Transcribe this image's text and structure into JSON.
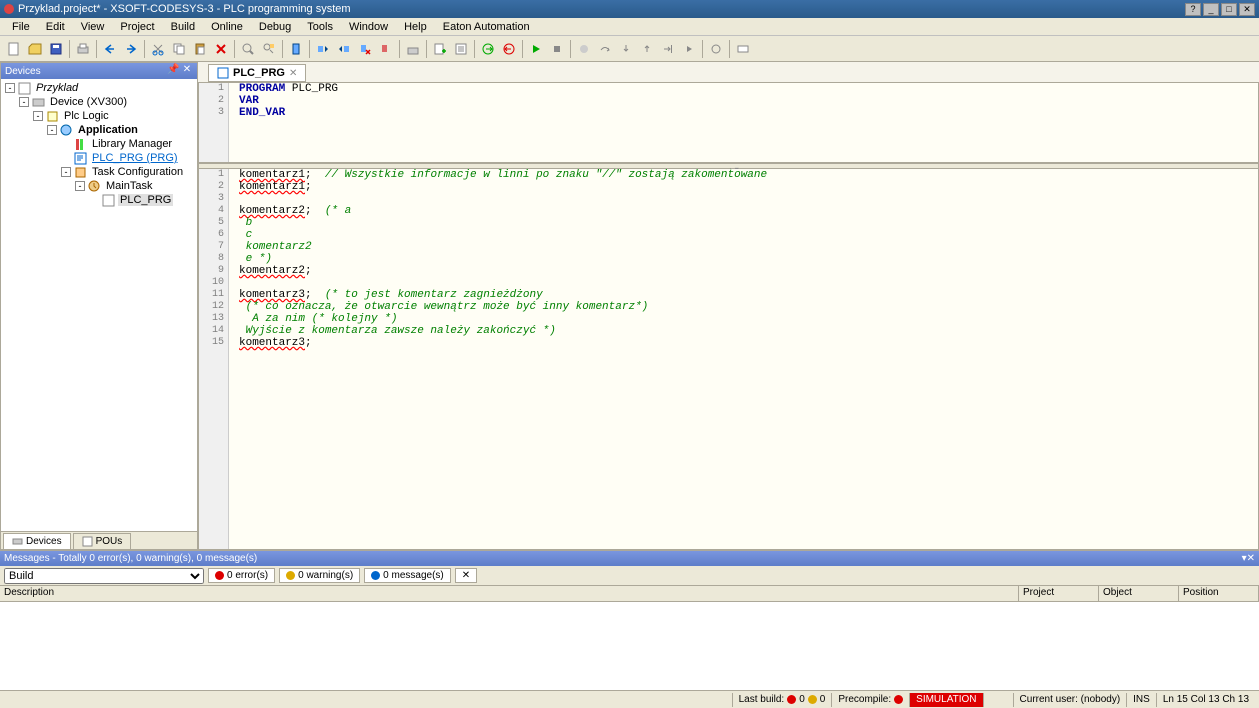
{
  "title": "Przyklad.project* - XSOFT-CODESYS-3 - PLC programming system",
  "menu": [
    "File",
    "Edit",
    "View",
    "Project",
    "Build",
    "Online",
    "Debug",
    "Tools",
    "Window",
    "Help",
    "Eaton Automation"
  ],
  "devicesPanel": {
    "title": "Devices"
  },
  "tree": {
    "root": "Przyklad",
    "device": "Device (XV300)",
    "plclogic": "Plc Logic",
    "app": "Application",
    "libmgr": "Library Manager",
    "plcprg": "PLC_PRG (PRG)",
    "taskcfg": "Task Configuration",
    "maintask": "MainTask",
    "plcprg2": "PLC_PRG"
  },
  "bottomTabs": {
    "devices": "Devices",
    "pous": "POUs"
  },
  "editorTab": "PLC_PRG",
  "declLines": [
    {
      "n": "1",
      "t": [
        {
          "kw": "PROGRAM"
        },
        {
          "tx": " PLC_PRG"
        }
      ]
    },
    {
      "n": "2",
      "t": [
        {
          "kw": "VAR"
        }
      ]
    },
    {
      "n": "3",
      "t": [
        {
          "kw": "END_VAR"
        }
      ]
    }
  ],
  "bodyLines": [
    {
      "n": "1",
      "t": [
        {
          "ru": "komentarz1"
        },
        {
          "tx": ";  "
        },
        {
          "cm": "// Wszystkie informacje w linni po znaku \"//\" zostają zakomentowane"
        }
      ]
    },
    {
      "n": "2",
      "t": [
        {
          "ru": "komentarz1"
        },
        {
          "tx": ";"
        }
      ]
    },
    {
      "n": "3",
      "t": []
    },
    {
      "n": "4",
      "t": [
        {
          "ru": "komentarz2"
        },
        {
          "tx": ";  "
        },
        {
          "cm": "(* a"
        }
      ]
    },
    {
      "n": "5",
      "t": [
        {
          "cm": " b"
        }
      ]
    },
    {
      "n": "6",
      "t": [
        {
          "cm": " c"
        }
      ]
    },
    {
      "n": "7",
      "t": [
        {
          "cm": " komentarz2"
        }
      ]
    },
    {
      "n": "8",
      "t": [
        {
          "cm": " e *)"
        }
      ]
    },
    {
      "n": "9",
      "t": [
        {
          "ru": "komentarz2"
        },
        {
          "tx": ";"
        }
      ]
    },
    {
      "n": "10",
      "t": []
    },
    {
      "n": "11",
      "t": [
        {
          "ru": "komentarz3"
        },
        {
          "tx": ";  "
        },
        {
          "cm": "(* to jest komentarz zagnieżdżony"
        }
      ]
    },
    {
      "n": "12",
      "t": [
        {
          "cm": " (* co oznacza, że otwarcie wewnątrz może być inny komentarz*)"
        }
      ]
    },
    {
      "n": "13",
      "t": [
        {
          "cm": "  A za nim (* kolejny *)"
        }
      ]
    },
    {
      "n": "14",
      "t": [
        {
          "cm": " Wyjście z komentarza zawsze należy zakończyć *)"
        }
      ]
    },
    {
      "n": "15",
      "t": [
        {
          "ru": "komentarz3"
        },
        {
          "tx": ";"
        }
      ]
    }
  ],
  "messages": {
    "header": "Messages - Totally 0 error(s), 0 warning(s), 0 message(s)",
    "combo": "Build",
    "errors": "0 error(s)",
    "warnings": "0 warning(s)",
    "msgs": "0 message(s)",
    "cols": {
      "desc": "Description",
      "project": "Project",
      "object": "Object",
      "position": "Position"
    }
  },
  "status": {
    "lastbuild": "Last build:",
    "lb_e": "0",
    "lb_w": "0",
    "precompile": "Precompile:",
    "sim": "SIMULATION",
    "user": "Current user: (nobody)",
    "ins": "INS",
    "pos": "Ln 15    Col 13    Ch 13"
  }
}
